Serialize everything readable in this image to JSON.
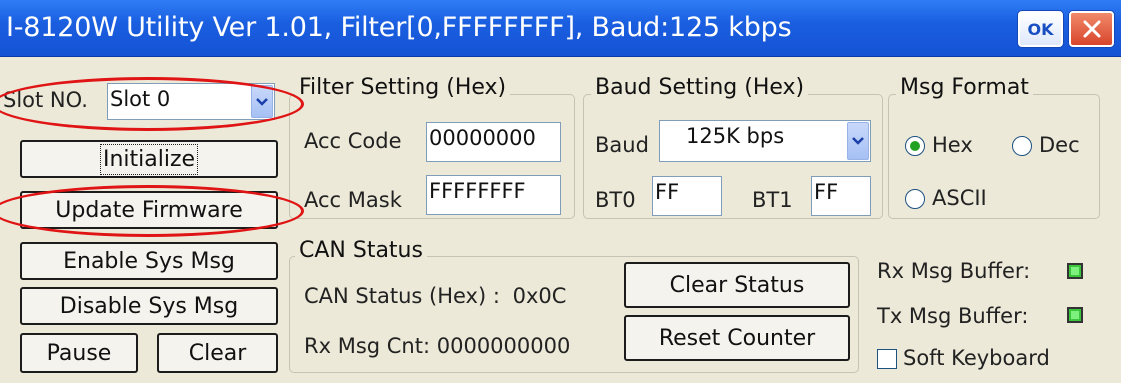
{
  "window": {
    "title": "I-8120W Utility Ver 1.01, Filter[0,FFFFFFFF], Baud:125 kbps",
    "ok_label": "OK",
    "close_label": "×"
  },
  "left": {
    "slot_label": "Slot NO.",
    "slot_value": "Slot 0",
    "initialize": "Initialize",
    "update_firmware": "Update Firmware",
    "enable_sys_msg": "Enable Sys Msg",
    "disable_sys_msg": "Disable Sys Msg",
    "pause": "Pause",
    "clear": "Clear"
  },
  "filter": {
    "title": "Filter Setting (Hex)",
    "acc_code_label": "Acc Code",
    "acc_code_value": "00000000",
    "acc_mask_label": "Acc Mask",
    "acc_mask_value": "FFFFFFFF"
  },
  "baud": {
    "title": "Baud Setting (Hex)",
    "baud_label": "Baud",
    "baud_value": "125K bps",
    "bt0_label": "BT0",
    "bt0_value": "FF",
    "bt1_label": "BT1",
    "bt1_value": "FF"
  },
  "msg_format": {
    "title": "Msg Format",
    "hex": "Hex",
    "dec": "Dec",
    "ascii": "ASCII",
    "selected": "Hex"
  },
  "can_status": {
    "title": "CAN Status",
    "status_label": "CAN Status (Hex) :",
    "status_value": "0x0C",
    "rx_cnt_label": "Rx Msg Cnt:",
    "rx_cnt_value": "0000000000",
    "clear_status": "Clear Status",
    "reset_counter": "Reset Counter"
  },
  "buffers": {
    "rx_label": "Rx Msg Buffer:",
    "tx_label": "Tx Msg Buffer:",
    "soft_keyboard": "Soft Keyboard"
  },
  "colors": {
    "titlebar": "#1a5fe0",
    "annotation": "#e01414",
    "led": "#3cc43c"
  }
}
